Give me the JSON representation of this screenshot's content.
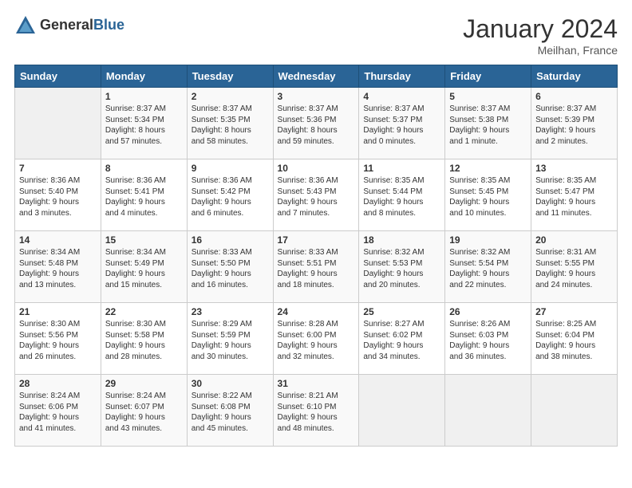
{
  "header": {
    "logo_general": "General",
    "logo_blue": "Blue",
    "month_title": "January 2024",
    "location": "Meilhan, France"
  },
  "calendar": {
    "days_of_week": [
      "Sunday",
      "Monday",
      "Tuesday",
      "Wednesday",
      "Thursday",
      "Friday",
      "Saturday"
    ],
    "weeks": [
      [
        {
          "day": "",
          "info": ""
        },
        {
          "day": "1",
          "info": "Sunrise: 8:37 AM\nSunset: 5:34 PM\nDaylight: 8 hours\nand 57 minutes."
        },
        {
          "day": "2",
          "info": "Sunrise: 8:37 AM\nSunset: 5:35 PM\nDaylight: 8 hours\nand 58 minutes."
        },
        {
          "day": "3",
          "info": "Sunrise: 8:37 AM\nSunset: 5:36 PM\nDaylight: 8 hours\nand 59 minutes."
        },
        {
          "day": "4",
          "info": "Sunrise: 8:37 AM\nSunset: 5:37 PM\nDaylight: 9 hours\nand 0 minutes."
        },
        {
          "day": "5",
          "info": "Sunrise: 8:37 AM\nSunset: 5:38 PM\nDaylight: 9 hours\nand 1 minute."
        },
        {
          "day": "6",
          "info": "Sunrise: 8:37 AM\nSunset: 5:39 PM\nDaylight: 9 hours\nand 2 minutes."
        }
      ],
      [
        {
          "day": "7",
          "info": "Sunrise: 8:36 AM\nSunset: 5:40 PM\nDaylight: 9 hours\nand 3 minutes."
        },
        {
          "day": "8",
          "info": "Sunrise: 8:36 AM\nSunset: 5:41 PM\nDaylight: 9 hours\nand 4 minutes."
        },
        {
          "day": "9",
          "info": "Sunrise: 8:36 AM\nSunset: 5:42 PM\nDaylight: 9 hours\nand 6 minutes."
        },
        {
          "day": "10",
          "info": "Sunrise: 8:36 AM\nSunset: 5:43 PM\nDaylight: 9 hours\nand 7 minutes."
        },
        {
          "day": "11",
          "info": "Sunrise: 8:35 AM\nSunset: 5:44 PM\nDaylight: 9 hours\nand 8 minutes."
        },
        {
          "day": "12",
          "info": "Sunrise: 8:35 AM\nSunset: 5:45 PM\nDaylight: 9 hours\nand 10 minutes."
        },
        {
          "day": "13",
          "info": "Sunrise: 8:35 AM\nSunset: 5:47 PM\nDaylight: 9 hours\nand 11 minutes."
        }
      ],
      [
        {
          "day": "14",
          "info": "Sunrise: 8:34 AM\nSunset: 5:48 PM\nDaylight: 9 hours\nand 13 minutes."
        },
        {
          "day": "15",
          "info": "Sunrise: 8:34 AM\nSunset: 5:49 PM\nDaylight: 9 hours\nand 15 minutes."
        },
        {
          "day": "16",
          "info": "Sunrise: 8:33 AM\nSunset: 5:50 PM\nDaylight: 9 hours\nand 16 minutes."
        },
        {
          "day": "17",
          "info": "Sunrise: 8:33 AM\nSunset: 5:51 PM\nDaylight: 9 hours\nand 18 minutes."
        },
        {
          "day": "18",
          "info": "Sunrise: 8:32 AM\nSunset: 5:53 PM\nDaylight: 9 hours\nand 20 minutes."
        },
        {
          "day": "19",
          "info": "Sunrise: 8:32 AM\nSunset: 5:54 PM\nDaylight: 9 hours\nand 22 minutes."
        },
        {
          "day": "20",
          "info": "Sunrise: 8:31 AM\nSunset: 5:55 PM\nDaylight: 9 hours\nand 24 minutes."
        }
      ],
      [
        {
          "day": "21",
          "info": "Sunrise: 8:30 AM\nSunset: 5:56 PM\nDaylight: 9 hours\nand 26 minutes."
        },
        {
          "day": "22",
          "info": "Sunrise: 8:30 AM\nSunset: 5:58 PM\nDaylight: 9 hours\nand 28 minutes."
        },
        {
          "day": "23",
          "info": "Sunrise: 8:29 AM\nSunset: 5:59 PM\nDaylight: 9 hours\nand 30 minutes."
        },
        {
          "day": "24",
          "info": "Sunrise: 8:28 AM\nSunset: 6:00 PM\nDaylight: 9 hours\nand 32 minutes."
        },
        {
          "day": "25",
          "info": "Sunrise: 8:27 AM\nSunset: 6:02 PM\nDaylight: 9 hours\nand 34 minutes."
        },
        {
          "day": "26",
          "info": "Sunrise: 8:26 AM\nSunset: 6:03 PM\nDaylight: 9 hours\nand 36 minutes."
        },
        {
          "day": "27",
          "info": "Sunrise: 8:25 AM\nSunset: 6:04 PM\nDaylight: 9 hours\nand 38 minutes."
        }
      ],
      [
        {
          "day": "28",
          "info": "Sunrise: 8:24 AM\nSunset: 6:06 PM\nDaylight: 9 hours\nand 41 minutes."
        },
        {
          "day": "29",
          "info": "Sunrise: 8:24 AM\nSunset: 6:07 PM\nDaylight: 9 hours\nand 43 minutes."
        },
        {
          "day": "30",
          "info": "Sunrise: 8:22 AM\nSunset: 6:08 PM\nDaylight: 9 hours\nand 45 minutes."
        },
        {
          "day": "31",
          "info": "Sunrise: 8:21 AM\nSunset: 6:10 PM\nDaylight: 9 hours\nand 48 minutes."
        },
        {
          "day": "",
          "info": ""
        },
        {
          "day": "",
          "info": ""
        },
        {
          "day": "",
          "info": ""
        }
      ]
    ]
  }
}
